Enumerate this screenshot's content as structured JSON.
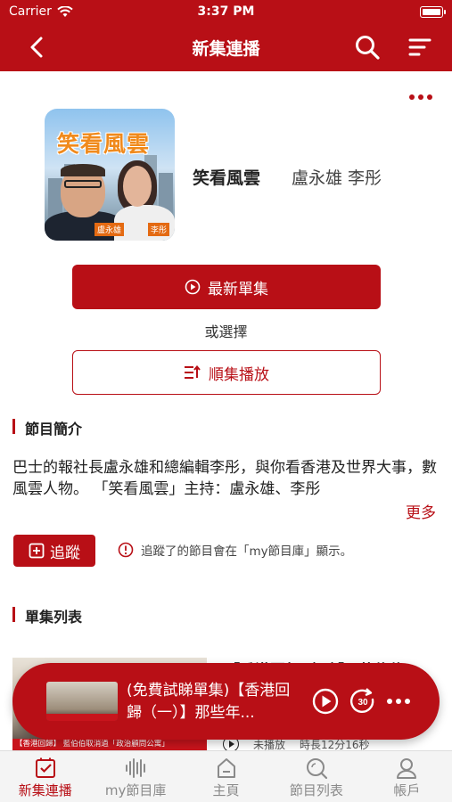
{
  "status": {
    "carrier": "Carrier",
    "time": "3:37 PM"
  },
  "nav": {
    "title": "新集連播"
  },
  "podcast": {
    "cover_title": "笑看風雲",
    "cover_tag_left": "盧永雄",
    "cover_tag_right": "李彤",
    "name": "笑看風雲",
    "hosts": "盧永雄 李彤"
  },
  "actions": {
    "latest_label": "最新單集",
    "or_label": "或選擇",
    "sequential_label": "順集播放"
  },
  "intro": {
    "heading": "節目簡介",
    "text": "巴士的報社長盧永雄和總編輯李彤，與你看香港及世界大事，數風雲人物。 「笑看風雲」主持：盧永雄、李彤",
    "more": "更多"
  },
  "follow": {
    "label": "追蹤",
    "note": "追蹤了的節目會在「my節目庫」顯示。"
  },
  "episodes": {
    "heading": "單集列表",
    "items": [
      {
        "title": "【香港回歸（三）】 藍伯伯",
        "thumb_caption": "【香港回歸】 藍伯伯取消過「政治顧問公寓」",
        "status": "未播放",
        "duration": "時長12分16秒"
      }
    ]
  },
  "player": {
    "title": "(免費試睇單集)【香港回歸（一）】那些年...",
    "skip_seconds": "30"
  },
  "tabs": [
    {
      "label": "新集連播",
      "icon": "new-episodes-icon",
      "active": true
    },
    {
      "label": "my節目庫",
      "icon": "library-icon",
      "active": false
    },
    {
      "label": "主頁",
      "icon": "home-icon",
      "active": false
    },
    {
      "label": "節目列表",
      "icon": "program-list-icon",
      "active": false
    },
    {
      "label": "帳戶",
      "icon": "account-icon",
      "active": false
    }
  ],
  "colors": {
    "brand": "#b80f16",
    "tab_inactive": "#8a8a8a",
    "tabbar_bg": "#f4f4f4"
  }
}
